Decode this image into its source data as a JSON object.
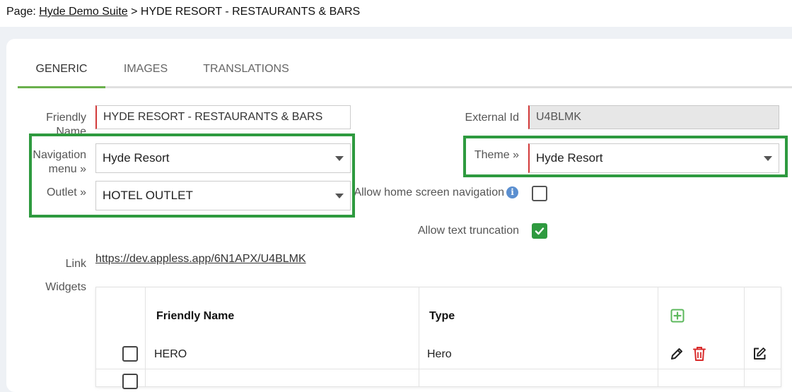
{
  "breadcrumb": {
    "prefix": "Page:",
    "parent": "Hyde Demo Suite",
    "separator": ">",
    "current": "HYDE RESORT - RESTAURANTS & BARS"
  },
  "tabs": [
    {
      "label": "GENERIC",
      "active": true
    },
    {
      "label": "IMAGES",
      "active": false
    },
    {
      "label": "TRANSLATIONS",
      "active": false
    }
  ],
  "form": {
    "friendly_name": {
      "label": "Friendly Name",
      "value": "HYDE RESORT - RESTAURANTS & BARS"
    },
    "external_id": {
      "label": "External Id",
      "value": "U4BLMK"
    },
    "navigation_menu": {
      "label": "Navigation menu",
      "value": "Hyde Resort"
    },
    "theme": {
      "label": "Theme",
      "value": "Hyde Resort"
    },
    "outlet": {
      "label": "Outlet",
      "value": "HOTEL OUTLET"
    },
    "allow_home_nav": {
      "label": "Allow home screen navigation",
      "checked": false
    },
    "allow_text_truncation": {
      "label": "Allow text truncation",
      "checked": true
    },
    "link": {
      "label": "Link",
      "value": "https://dev.appless.app/6N1APX/U4BLMK"
    },
    "widgets_label": "Widgets"
  },
  "widgets_table": {
    "columns": [
      "Friendly Name",
      "Type"
    ],
    "rows": [
      {
        "friendly_name": "HERO",
        "type": "Hero"
      }
    ]
  },
  "colors": {
    "accent_green": "#2e9a3f",
    "tab_underline": "#6ab04c",
    "required_red": "#d23a3a",
    "delete_red": "#d92b2b"
  }
}
